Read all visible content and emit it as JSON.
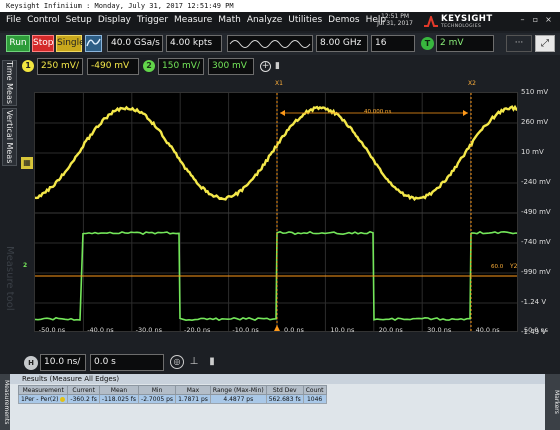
{
  "window_title": "Keysight Infiniium : Monday, July 31, 2017 12:51:49 PM",
  "menu": [
    "File",
    "Control",
    "Setup",
    "Display",
    "Trigger",
    "Measure",
    "Math",
    "Analyze",
    "Utilities",
    "Demos",
    "Help"
  ],
  "clock": {
    "time": "12:51 PM",
    "date": "Jul 31, 2017"
  },
  "brand": {
    "name": "KEYSIGHT",
    "sub": "TECHNOLOGIES"
  },
  "toolbar": {
    "run": "Run",
    "stop": "Stop",
    "single": "Single",
    "sample_rate": "40.0 GSa/s",
    "memory_depth": "4.00 kpts",
    "bandwidth": "8.00 GHz",
    "averages": "16",
    "trigger_badge": "T",
    "trigger_level": "2 mV",
    "more": "···",
    "expand": "⤢"
  },
  "side_tabs": {
    "time": "Time Meas",
    "vertical": "Vertical Meas",
    "ghost": "Measure tool"
  },
  "channels": {
    "ch1": {
      "badge": "1",
      "scale": "250 mV/",
      "offset": "-490 mV",
      "color": "#f4e84a"
    },
    "ch2": {
      "badge": "2",
      "scale": "150 mV/",
      "offset": "300 mV",
      "color": "#74e65a"
    }
  },
  "y_axis_labels": [
    "510 mV",
    "260 mV",
    "10 mV",
    "-240 mV",
    "-490 mV",
    "-740 mV",
    "-990 mV",
    "-1.24 V",
    "-1.49 V"
  ],
  "x_axis_labels": [
    "-50.0 ns",
    "-40.0 ns",
    "-30.0 ns",
    "-20.0 ns",
    "-10.0 ns",
    "0.0 ns",
    "10.0 ns",
    "20.0 ns",
    "30.0 ns",
    "40.0 ns",
    "50.0 ns"
  ],
  "markers": {
    "x1": "X1",
    "x2": "X2",
    "delta": "40.000 ns",
    "y2": "Y2",
    "ch": "2",
    "trig_level": "60.0"
  },
  "horizontal": {
    "badge": "H",
    "scale": "10.0 ns/",
    "position": "0.0 s"
  },
  "results": {
    "header": "Results   (Measure All Edges)",
    "side_tab": "Measurements",
    "markers_tab": "Markers",
    "columns": [
      "Measurement",
      "Current",
      "Mean",
      "Min",
      "Max",
      "Range (Max-Min)",
      "Std Dev",
      "Count"
    ],
    "rows": [
      [
        "1Per - Per(2)",
        "-360.2 fs",
        "-118.025 fs",
        "-2.7005 ps",
        "1.7871 ps",
        "4.4877 ps",
        "562.683 fs",
        "1046"
      ]
    ]
  }
}
